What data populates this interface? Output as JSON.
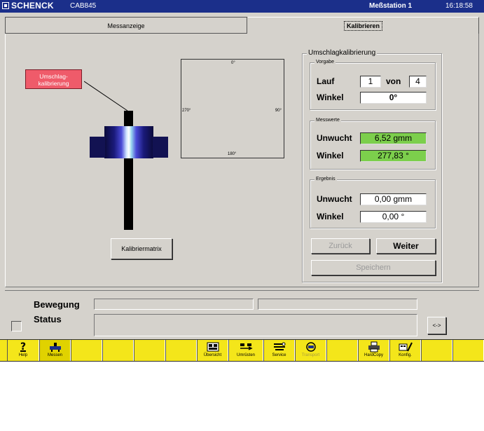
{
  "titlebar": {
    "brand": "SCHENCK",
    "model": "CAB845",
    "station": "Meßstation 1",
    "time": "16:18:58"
  },
  "tabs": [
    {
      "label": "Messanzeige"
    },
    {
      "label": "Kalibrieren"
    }
  ],
  "diagram": {
    "tag_label": "Umschlag-kalibrierung",
    "angles": {
      "top": "0°",
      "right": "90°",
      "bottom": "180°",
      "left": "270°"
    }
  },
  "kalibriermatrix_button": "Kalibriermatrix",
  "calibration": {
    "title": "Umschlagkalibrierung",
    "vorgabe": {
      "title": "Vorgabe",
      "lauf_label": "Lauf",
      "lauf_value": "1",
      "von_label": "von",
      "von_value": "4",
      "winkel_label": "Winkel",
      "winkel_value": "0°"
    },
    "messwerte": {
      "title": "Messwerte",
      "unwucht_label": "Unwucht",
      "unwucht_value": "6,52 gmm",
      "winkel_label": "Winkel",
      "winkel_value": "277,83 °"
    },
    "ergebnis": {
      "title": "Ergebnis",
      "unwucht_label": "Unwucht",
      "unwucht_value": "0,00 gmm",
      "winkel_label": "Winkel",
      "winkel_value": "0,00 °"
    },
    "zurueck_button": "Zurück",
    "weiter_button": "Weiter",
    "speichern_button": "Speichern"
  },
  "status": {
    "bewegung_label": "Bewegung",
    "status_label": "Status",
    "arrow_button": "<->"
  },
  "toolbar": {
    "help": "Help",
    "messen": "Messen",
    "uebersicht": "Übersicht",
    "umruesten": "Umrüsten",
    "service": "Service",
    "transport": "Transport",
    "hardcopy": "HardCopy",
    "konfig": "Konfig."
  },
  "colors": {
    "titlebar": "#1b2f8a",
    "toolbar": "#f4e61a",
    "measured_field": "#7ccf4c",
    "tag": "#ef5b6a"
  }
}
